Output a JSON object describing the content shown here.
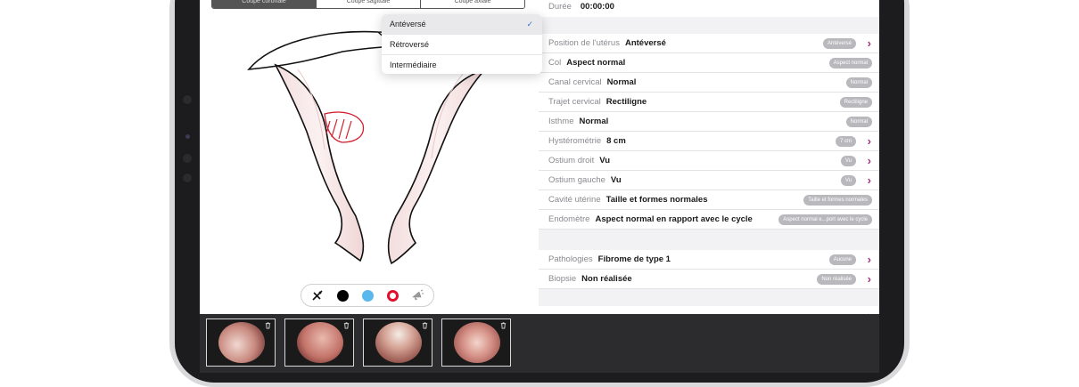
{
  "segmented": {
    "tabs": [
      {
        "label": "Coupe coronale",
        "active": true
      },
      {
        "label": "Coupe sagittale",
        "active": false
      },
      {
        "label": "Coupe axiale",
        "active": false
      }
    ]
  },
  "dropdown": {
    "options": [
      {
        "label": "Antéversé",
        "selected": true
      },
      {
        "label": "Rétroversé",
        "selected": false
      },
      {
        "label": "Intermédiaire",
        "selected": false
      }
    ]
  },
  "duration": {
    "label": "Durée",
    "value": "00:00:00"
  },
  "fields": [
    {
      "label": "Position de l'utérus",
      "value": "Antéversé",
      "badge": "Antéversé",
      "chevron": true
    },
    {
      "label": "Col",
      "value": "Aspect normal",
      "badge": "Aspect normal",
      "chevron": false
    },
    {
      "label": "Canal cervical",
      "value": "Normal",
      "badge": "Normal",
      "chevron": false
    },
    {
      "label": "Trajet cervical",
      "value": "Rectiligne",
      "badge": "Rectiligne",
      "chevron": false
    },
    {
      "label": "Isthme",
      "value": "Normal",
      "badge": "Normal",
      "chevron": false
    },
    {
      "label": "Hystérométrie",
      "value": "8 cm",
      "badge": "7 cm",
      "chevron": true
    },
    {
      "label": "Ostium droit",
      "value": "Vu",
      "badge": "Vu",
      "chevron": true
    },
    {
      "label": "Ostium gauche",
      "value": "Vu",
      "badge": "Vu",
      "chevron": true
    },
    {
      "label": "Cavité utérine",
      "value": "Taille et formes normales",
      "badge": "Taille et formes normales",
      "chevron": false
    },
    {
      "label": "Endomètre",
      "value": "Aspect normal en rapport avec le cycle",
      "badge": "Aspect normal e...port avec le cycle",
      "chevron": false
    }
  ],
  "fields2": [
    {
      "label": "Pathologies",
      "value": "Fibrome de type 1",
      "badge": "Aucune",
      "chevron": true
    },
    {
      "label": "Biopsie",
      "value": "Non réalisée",
      "badge": "Non réalisée",
      "chevron": true
    }
  ],
  "colors": {
    "accent_chevron": "#a0327a",
    "check": "#3b6fd6",
    "black": "#000000",
    "blue": "#5ab8ec",
    "red": "#e0102a"
  },
  "toolbar": {
    "tools": [
      "pencil-eraser-icon",
      "black-color-dot",
      "blue-color-dot",
      "red-color-dot",
      "megaphone-icon"
    ]
  },
  "thumbnails": [
    {
      "name": "hysteroscopy-image-1"
    },
    {
      "name": "hysteroscopy-image-2"
    },
    {
      "name": "hysteroscopy-image-3"
    },
    {
      "name": "hysteroscopy-image-4"
    }
  ]
}
